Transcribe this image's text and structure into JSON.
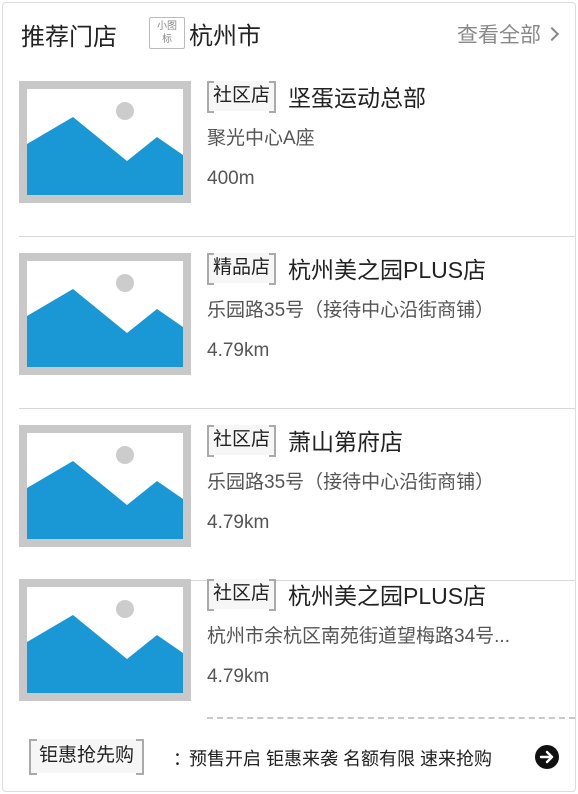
{
  "header": {
    "title": "推荐门店",
    "city_tag_line1": "小图",
    "city_tag_line2": "标",
    "city": "杭州市",
    "view_all": "查看全部"
  },
  "stores": [
    {
      "badge": "社区店",
      "name": "坚蛋运动总部",
      "address": "聚光中心A座",
      "distance": "400m"
    },
    {
      "badge": "精品店",
      "name": "杭州美之园PLUS店",
      "address": "乐园路35号（接待中心沿街商铺）",
      "distance": "4.79km"
    },
    {
      "badge": "社区店",
      "name": "萧山第府店",
      "address": "乐园路35号（接待中心沿街商铺）",
      "distance": "4.79km"
    },
    {
      "badge": "社区店",
      "name": "杭州美之园PLUS店",
      "address": "杭州市余杭区南苑街道望梅路34号...",
      "distance": "4.79km"
    }
  ],
  "promo": {
    "tag": "钜惠抢先购",
    "colon": "：",
    "text": "预售开启 钜惠来袭 名额有限 速来抢购"
  },
  "icons": {
    "thumbnail": "image-placeholder-icon",
    "view_all": "chevron-right-icon",
    "promo_go": "arrow-circle-right-icon"
  },
  "colors": {
    "mountain": "#1a97d5",
    "sun": "#cccccc",
    "frame": "#c8c8c8"
  }
}
